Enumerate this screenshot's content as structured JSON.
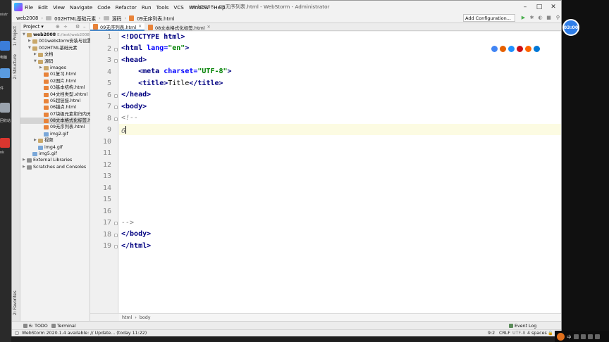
{
  "window": {
    "title": "web2008 - 09无序列表.html - WebStorm - Administrator",
    "menu": [
      "File",
      "Edit",
      "View",
      "Navigate",
      "Code",
      "Refactor",
      "Run",
      "Tools",
      "VCS",
      "Window",
      "Help"
    ]
  },
  "navbar": {
    "crumbs": [
      "web2008",
      "002HTML基础元素",
      "源码",
      "09无序列表.html"
    ],
    "add_configuration": "Add Configuration..."
  },
  "tool_windows": {
    "project_tab": "1: Project",
    "structure_tab": "2: Structure",
    "favorites_tab": "2: Favorites",
    "todo": "6: TODO",
    "terminal": "Terminal",
    "event_log": "Event Log"
  },
  "project": {
    "header": "Project",
    "tree": [
      {
        "label": "web2008",
        "suffix": "E:/test/web2008",
        "depth": 0,
        "kind": "folder",
        "expanded": true,
        "bold": true
      },
      {
        "label": "001webstorm安装与设置",
        "depth": 1,
        "kind": "folder",
        "expanded": false
      },
      {
        "label": "002HTML基础元素",
        "depth": 1,
        "kind": "folder",
        "expanded": true
      },
      {
        "label": "文档",
        "depth": 2,
        "kind": "folder",
        "expanded": false
      },
      {
        "label": "源码",
        "depth": 2,
        "kind": "folder",
        "expanded": true
      },
      {
        "label": "images",
        "depth": 3,
        "kind": "folder",
        "expanded": false
      },
      {
        "label": "01复习.html",
        "depth": 3,
        "kind": "html"
      },
      {
        "label": "02图片.html",
        "depth": 3,
        "kind": "html"
      },
      {
        "label": "03基本结构.html",
        "depth": 3,
        "kind": "html"
      },
      {
        "label": "04文档类型.xhtml",
        "depth": 3,
        "kind": "html"
      },
      {
        "label": "05超链接.html",
        "depth": 3,
        "kind": "html"
      },
      {
        "label": "06锚点.html",
        "depth": 3,
        "kind": "html"
      },
      {
        "label": "07块级元素和行内元素",
        "depth": 3,
        "kind": "html"
      },
      {
        "label": "08文本格式化标签.html",
        "depth": 3,
        "kind": "html",
        "selected": true
      },
      {
        "label": "09无序列表.html",
        "depth": 3,
        "kind": "html"
      },
      {
        "label": "img2.gif",
        "depth": 3,
        "kind": "gif"
      },
      {
        "label": "视频",
        "depth": 2,
        "kind": "folder",
        "expanded": false
      },
      {
        "label": "img4.gif",
        "depth": 2,
        "kind": "gif"
      },
      {
        "label": "img5.gif",
        "depth": 1,
        "kind": "gif"
      },
      {
        "label": "External Libraries",
        "depth": 0,
        "kind": "lib",
        "expanded": false
      },
      {
        "label": "Scratches and Consoles",
        "depth": 0,
        "kind": "scratch",
        "expanded": false
      }
    ]
  },
  "editor": {
    "tabs": [
      {
        "label": "09无序列表.html",
        "active": true
      },
      {
        "label": "08文本格式化标签.html",
        "active": false
      }
    ],
    "line_numbers": [
      "1",
      "2",
      "3",
      "4",
      "5",
      "6",
      "7",
      "8",
      "9",
      "10",
      "11",
      "12",
      "13",
      "14",
      "15",
      "16",
      "17",
      "18",
      "19"
    ],
    "current_line": 9,
    "breadcrumb": [
      "html",
      "body"
    ]
  },
  "desktop": {
    "timer": "03:00",
    "left_labels": [
      "nistr",
      "电脑",
      "件",
      "回收站",
      "nk"
    ],
    "tray_text": "中"
  },
  "status": {
    "message": "WebStorm 2020.1.4 available: // Update... (today 11:22)",
    "position": "9:2",
    "line_sep": "CRLF",
    "encoding": "UTF-8",
    "indent": "4 spaces"
  },
  "colors": {
    "tag": "#000080",
    "attr": "#0000ff",
    "string": "#008000",
    "comment": "#808080",
    "current_line": "#fcfbe2",
    "timer": "#2f7ee8"
  }
}
